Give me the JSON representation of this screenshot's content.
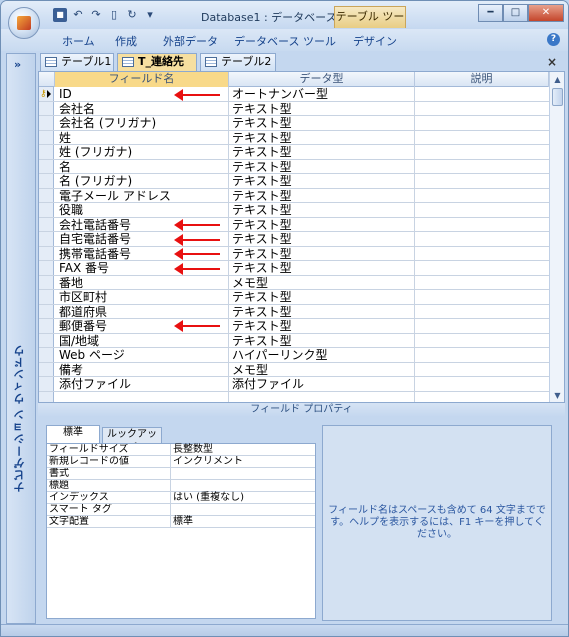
{
  "window": {
    "title": "Database1 : データベース ...",
    "context_tab": "テーブル ツール",
    "minimize": "━",
    "maximize": "□",
    "close": "✕"
  },
  "ribbon": {
    "tabs": [
      "ホーム",
      "作成",
      "外部データ",
      "データベース ツール",
      "デザイン"
    ]
  },
  "navigation_pane": {
    "label": "ナビゲーション ウィンドウ",
    "collapse": "»"
  },
  "doc_tabs": [
    "テーブル1",
    "T_連絡先",
    "テーブル2"
  ],
  "doc_close": "×",
  "grid": {
    "columns": [
      "フィールド名",
      "データ型",
      "説明"
    ],
    "rows": [
      {
        "field": "ID",
        "type": "オートナンバー型"
      },
      {
        "field": "会社名",
        "type": "テキスト型"
      },
      {
        "field": "会社名 (フリガナ)",
        "type": "テキスト型"
      },
      {
        "field": "姓",
        "type": "テキスト型"
      },
      {
        "field": "姓 (フリガナ)",
        "type": "テキスト型"
      },
      {
        "field": "名",
        "type": "テキスト型"
      },
      {
        "field": "名 (フリガナ)",
        "type": "テキスト型"
      },
      {
        "field": "電子メール アドレス",
        "type": "テキスト型"
      },
      {
        "field": "役職",
        "type": "テキスト型"
      },
      {
        "field": "会社電話番号",
        "type": "テキスト型"
      },
      {
        "field": "自宅電話番号",
        "type": "テキスト型"
      },
      {
        "field": "携帯電話番号",
        "type": "テキスト型"
      },
      {
        "field": "FAX 番号",
        "type": "テキスト型"
      },
      {
        "field": "番地",
        "type": "メモ型"
      },
      {
        "field": "市区町村",
        "type": "テキスト型"
      },
      {
        "field": "都道府県",
        "type": "テキスト型"
      },
      {
        "field": "郵便番号",
        "type": "テキスト型"
      },
      {
        "field": "国/地域",
        "type": "テキスト型"
      },
      {
        "field": "Web ページ",
        "type": "ハイパーリンク型"
      },
      {
        "field": "備考",
        "type": "メモ型"
      },
      {
        "field": "添付ファイル",
        "type": "添付ファイル"
      },
      {
        "field": "",
        "type": ""
      }
    ]
  },
  "field_properties": {
    "label": "フィールド プロパティ",
    "tabs": [
      "標準",
      "ルックアップ"
    ],
    "rows": [
      {
        "key": "フィールドサイズ",
        "value": "長整数型"
      },
      {
        "key": "新規レコードの値",
        "value": "インクリメント"
      },
      {
        "key": "書式",
        "value": ""
      },
      {
        "key": "標題",
        "value": ""
      },
      {
        "key": "インデックス",
        "value": "はい (重複なし)"
      },
      {
        "key": "スマート タグ",
        "value": ""
      },
      {
        "key": "文字配置",
        "value": "標準"
      }
    ],
    "help_text": "フィールド名はスペースも含めて 64 文字までです。ヘルプを表示するには、F1 キーを押してください。"
  },
  "colors": {
    "accent": "#15428b",
    "annotation_arrow": "#e81010",
    "active_tab": "#f6dfa0"
  }
}
